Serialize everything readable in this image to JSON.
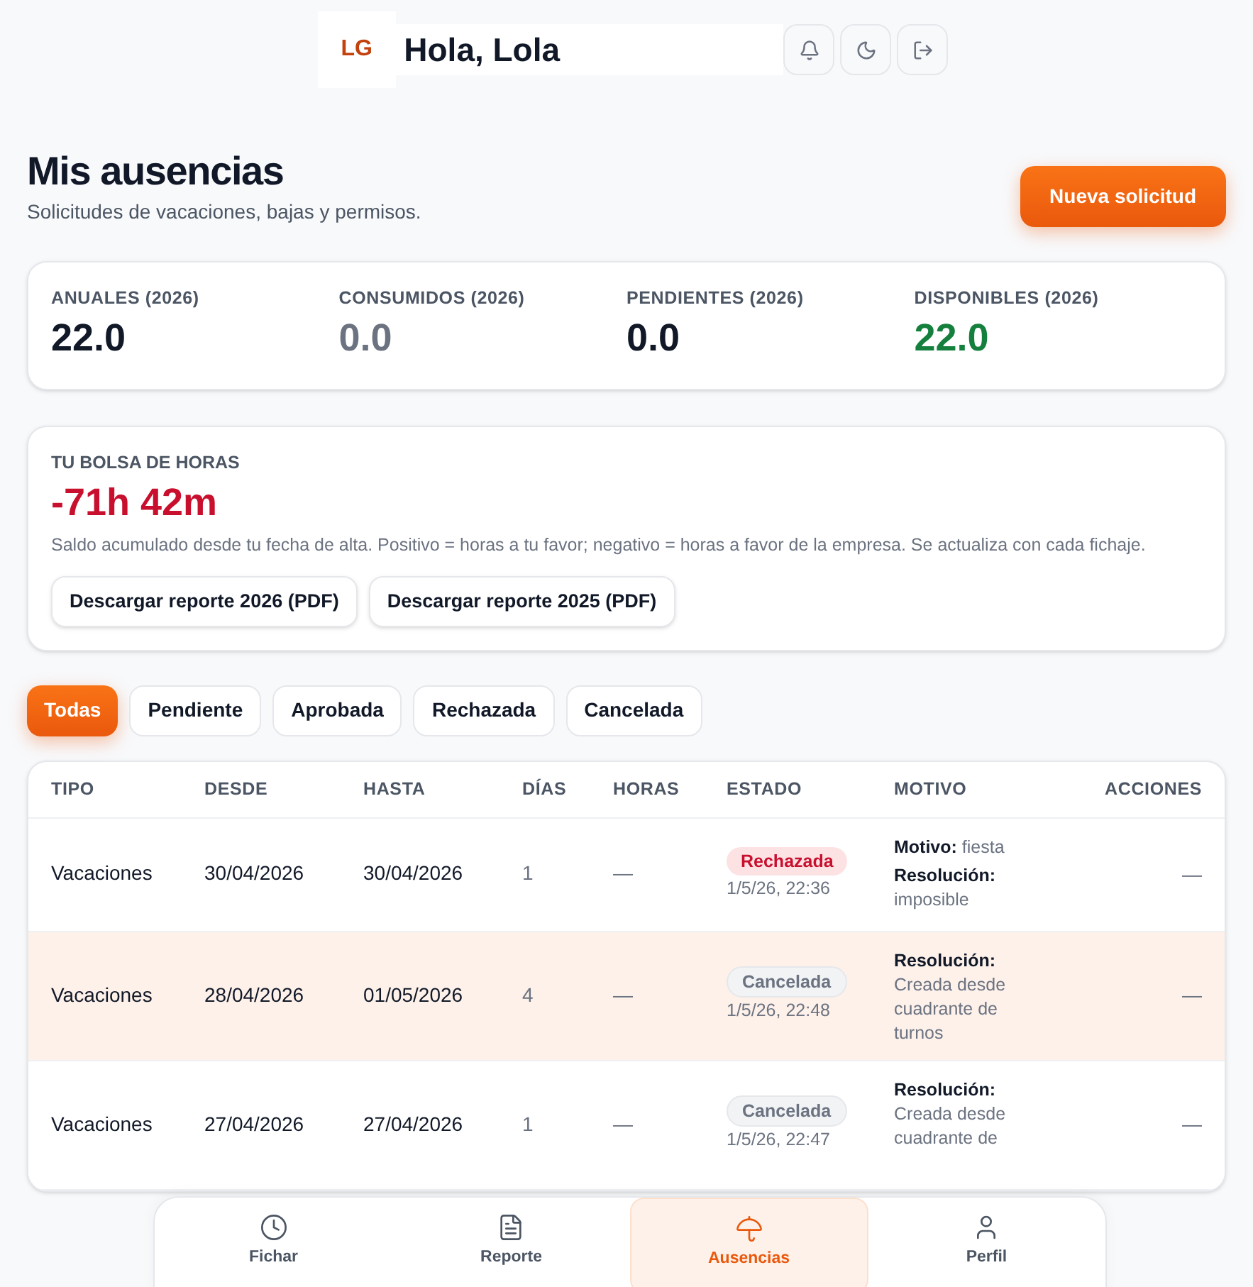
{
  "header": {
    "logo": "LG",
    "greeting": "Hola, Lola"
  },
  "page": {
    "title": "Mis ausencias",
    "subtitle": "Solicitudes de vacaciones, bajas y permisos.",
    "new_button": "Nueva solicitud"
  },
  "stats": [
    {
      "label": "ANUALES (2026)",
      "value": "22.0",
      "color": "#111827"
    },
    {
      "label": "CONSUMIDOS (2026)",
      "value": "0.0",
      "color": "#6b7280"
    },
    {
      "label": "PENDIENTES (2026)",
      "value": "0.0",
      "color": "#111827"
    },
    {
      "label": "DISPONIBLES (2026)",
      "value": "22.0",
      "color": "#15803d"
    }
  ],
  "hours_bank": {
    "title": "TU BOLSA DE HORAS",
    "value": "-71h 42m",
    "color": "#c8102e",
    "description": "Saldo acumulado desde tu fecha de alta. Positivo = horas a tu favor; negativo = horas a favor de la empresa. Se actualiza con cada fichaje.",
    "buttons": [
      "Descargar reporte 2026 (PDF)",
      "Descargar reporte 2025 (PDF)"
    ]
  },
  "filters": [
    {
      "label": "Todas",
      "selected": true
    },
    {
      "label": "Pendiente",
      "selected": false
    },
    {
      "label": "Aprobada",
      "selected": false
    },
    {
      "label": "Rechazada",
      "selected": false
    },
    {
      "label": "Cancelada",
      "selected": false
    }
  ],
  "table": {
    "columns": [
      "TIPO",
      "DESDE",
      "HASTA",
      "DÍAS",
      "HORAS",
      "ESTADO",
      "MOTIVO",
      "ACCIONES"
    ],
    "rows": [
      {
        "selected": false,
        "type": "Vacaciones",
        "from": "30/04/2026",
        "to": "30/04/2026",
        "days": "1",
        "hours": "—",
        "status": {
          "label": "Rechazada",
          "kind": "rejected",
          "time": "1/5/26, 22:36"
        },
        "reason_label": "Motivo:",
        "reason": "fiesta",
        "resolution_label": "Resolución:",
        "resolution": "imposible",
        "actions": "—"
      },
      {
        "selected": true,
        "type": "Vacaciones",
        "from": "28/04/2026",
        "to": "01/05/2026",
        "days": "4",
        "hours": "—",
        "status": {
          "label": "Cancelada",
          "kind": "cancelled",
          "time": "1/5/26, 22:48"
        },
        "resolution_label": "Resolución:",
        "resolution": "Creada desde cuadrante de turnos",
        "actions": "—"
      },
      {
        "selected": false,
        "type": "Vacaciones",
        "from": "27/04/2026",
        "to": "27/04/2026",
        "days": "1",
        "hours": "—",
        "status": {
          "label": "Cancelada",
          "kind": "cancelled",
          "time": "1/5/26, 22:47"
        },
        "resolution_label": "Resolución:",
        "resolution": "Creada desde cuadrante de",
        "actions": "—"
      }
    ]
  },
  "bottom_nav": [
    {
      "label": "Fichar",
      "selected": false
    },
    {
      "label": "Reporte",
      "selected": false
    },
    {
      "label": "Ausencias",
      "selected": true
    },
    {
      "label": "Perfil",
      "selected": false
    }
  ]
}
